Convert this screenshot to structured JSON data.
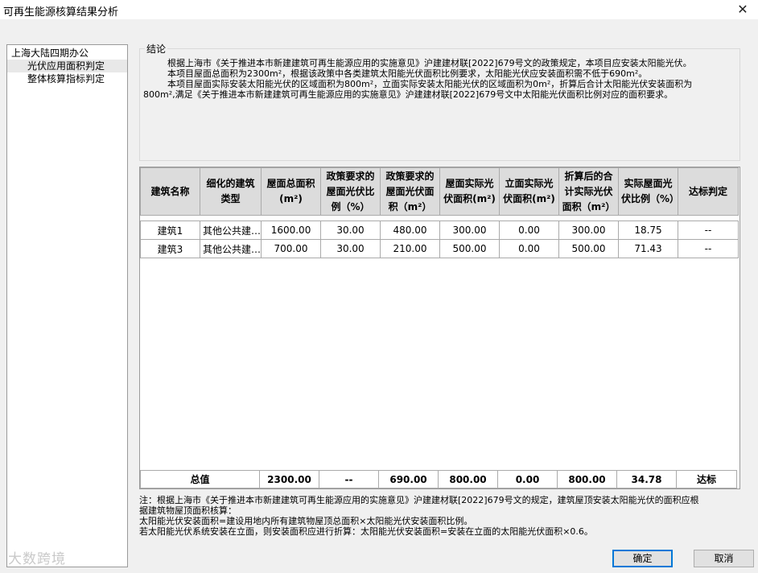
{
  "window": {
    "title": "可再生能源核算结果分析",
    "close_glyph": "✕"
  },
  "tree": {
    "root": "上海大陆四期办公",
    "children": [
      "光伏应用面积判定",
      "整体核算指标判定"
    ]
  },
  "conclusion": {
    "legend": "结论",
    "lines": [
      "根据上海市《关于推进本市新建建筑可再生能源应用的实施意见》沪建建材联[2022]679号文的政策规定，本项目应安装太阳能光伏。",
      "本项目屋面总面积为2300m²，根据该政策中各类建筑太阳能光伏面积比例要求，太阳能光伏应安装面积需不低于690m²。",
      "本项目屋面实际安装太阳能光伏的区域面积为800m²，立面实际安装太阳能光伏的区域面积为0m²，折算后合计太阳能光伏安装面积为",
      "800m²,满足《关于推进本市新建建筑可再生能源应用的实施意见》沪建建材联[2022]679号文中太阳能光伏面积比例对应的面积要求。"
    ]
  },
  "table": {
    "headers": [
      "建筑名称",
      "细化的建筑类型",
      "屋面总面积(m²)",
      "政策要求的屋面光伏比例（%）",
      "政策要求的屋面光伏面积（m²）",
      "屋面实际光伏面积(m²)",
      "立面实际光伏面积(m²)",
      "折算后的合计实际光伏面积（m²）",
      "实际屋面光伏比例（%）",
      "达标判定"
    ],
    "rows": [
      [
        "建筑1",
        "其他公共建…",
        "1600.00",
        "30.00",
        "480.00",
        "300.00",
        "0.00",
        "300.00",
        "18.75",
        "--"
      ],
      [
        "建筑3",
        "其他公共建…",
        "700.00",
        "30.00",
        "210.00",
        "500.00",
        "0.00",
        "500.00",
        "71.43",
        "--"
      ]
    ],
    "totals": {
      "label": "总值",
      "values": [
        "2300.00",
        "--",
        "690.00",
        "800.00",
        "0.00",
        "800.00",
        "34.78",
        "达标"
      ]
    }
  },
  "note": {
    "lines": [
      "注：根据上海市《关于推进本市新建建筑可再生能源应用的实施意见》沪建建材联[2022]679号文的规定，建筑屋顶安装太阳能光伏的面积应根",
      "据建筑物屋顶面积核算：",
      "太阳能光伏安装面积=建设用地内所有建筑物屋顶总面积×太阳能光伏安装面积比例。",
      "若太阳能光伏系统安装在立面，则安装面积应进行折算：太阳能光伏安装面积=安装在立面的太阳能光伏面积×0.6。"
    ]
  },
  "watermark": "大数跨境",
  "buttons": {
    "ok": "确定",
    "cancel": "取消"
  }
}
